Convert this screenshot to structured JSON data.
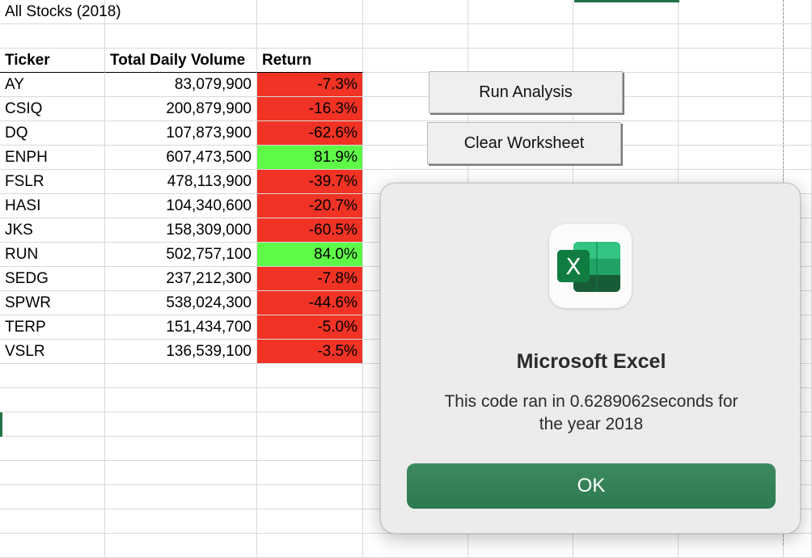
{
  "sheet": {
    "title": "All Stocks (2018)",
    "headers": {
      "ticker": "Ticker",
      "volume": "Total Daily Volume",
      "return": "Return"
    },
    "rows": [
      {
        "ticker": "AY",
        "volume": "83,079,900",
        "return": "-7.3%",
        "status": "negative"
      },
      {
        "ticker": "CSIQ",
        "volume": "200,879,900",
        "return": "-16.3%",
        "status": "negative"
      },
      {
        "ticker": "DQ",
        "volume": "107,873,900",
        "return": "-62.6%",
        "status": "negative"
      },
      {
        "ticker": "ENPH",
        "volume": "607,473,500",
        "return": "81.9%",
        "status": "positive"
      },
      {
        "ticker": "FSLR",
        "volume": "478,113,900",
        "return": "-39.7%",
        "status": "negative"
      },
      {
        "ticker": "HASI",
        "volume": "104,340,600",
        "return": "-20.7%",
        "status": "negative"
      },
      {
        "ticker": "JKS",
        "volume": "158,309,000",
        "return": "-60.5%",
        "status": "negative"
      },
      {
        "ticker": "RUN",
        "volume": "502,757,100",
        "return": "84.0%",
        "status": "positive"
      },
      {
        "ticker": "SEDG",
        "volume": "237,212,300",
        "return": "-7.8%",
        "status": "negative"
      },
      {
        "ticker": "SPWR",
        "volume": "538,024,300",
        "return": "-44.6%",
        "status": "negative"
      },
      {
        "ticker": "TERP",
        "volume": "151,434,700",
        "return": "-5.0%",
        "status": "negative"
      },
      {
        "ticker": "VSLR",
        "volume": "136,539,100",
        "return": "-3.5%",
        "status": "negative"
      }
    ]
  },
  "buttons": {
    "run_label": "Run Analysis",
    "clear_label": "Clear Worksheet"
  },
  "dialog": {
    "app_icon": "excel-app-icon",
    "icon_letter": "X",
    "title": "Microsoft Excel",
    "message_line1": "This code ran in 0.6289062seconds for",
    "message_line2": "the year 2018",
    "ok_label": "OK"
  },
  "colors": {
    "negative": "#f03324",
    "positive": "#5ffa48",
    "excel_green": "#217346",
    "ok_button": "#357f55"
  }
}
